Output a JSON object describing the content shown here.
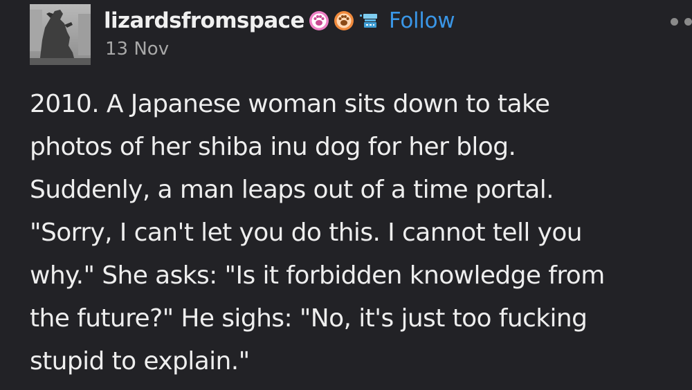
{
  "post": {
    "author": {
      "username": "lizardsfromspace",
      "avatar_icon": "godzilla-statue-avatar",
      "badges": [
        "paw-badge-pink",
        "paw-badge-orange",
        "robot-badge"
      ]
    },
    "follow_label": "Follow",
    "date": "13 Nov",
    "more_icon": "more-dots-icon",
    "body_lines": [
      "2010. A Japanese woman sits down to take",
      "photos of her shiba inu dog for her blog.",
      "Suddenly, a man leaps out of a time portal.",
      "\"Sorry, I can't let you do this. I cannot tell you",
      "why.\" She asks: \"Is it forbidden knowledge from",
      "the future?\" He sighs: \"No, it's just too fucking",
      "stupid to explain.\""
    ]
  },
  "colors": {
    "background": "#222226",
    "text": "#eeeeee",
    "follow_link": "#3a96e6",
    "date": "#a8a8a8"
  }
}
